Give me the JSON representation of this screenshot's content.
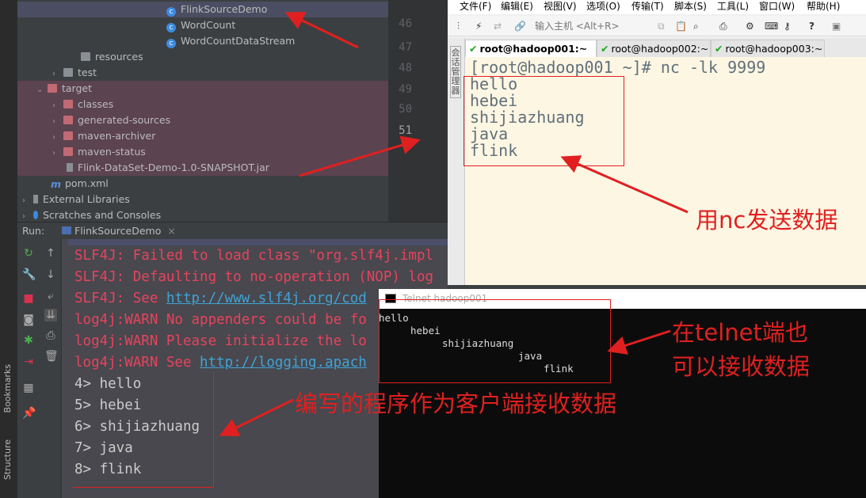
{
  "ide": {
    "left_strip": {
      "bookmarks": "Bookmarks",
      "structure": "Structure"
    },
    "tree": [
      {
        "label": "FlinkSourceDemo",
        "icon": "class-icon"
      },
      {
        "label": "WordCount",
        "icon": "class-icon"
      },
      {
        "label": "WordCountDataStream",
        "icon": "class-icon"
      },
      {
        "label": "resources",
        "icon": "folder-icon"
      },
      {
        "label": "test",
        "icon": "folder-icon"
      },
      {
        "label": "target",
        "icon": "folder-icon"
      },
      {
        "label": "classes",
        "icon": "folder-icon"
      },
      {
        "label": "generated-sources",
        "icon": "folder-icon"
      },
      {
        "label": "maven-archiver",
        "icon": "folder-icon"
      },
      {
        "label": "maven-status",
        "icon": "folder-icon"
      },
      {
        "label": "Flink-DataSet-Demo-1.0-SNAPSHOT.jar",
        "icon": "jar-icon"
      },
      {
        "label": "pom.xml",
        "icon": "maven-icon"
      },
      {
        "label": "External Libraries",
        "icon": "library-icon"
      },
      {
        "label": "Scratches and Consoles",
        "icon": "scratch-icon"
      }
    ],
    "line_numbers": [
      "46",
      "47",
      "48",
      "49",
      "50",
      "51"
    ],
    "run": {
      "label": "Run:",
      "tab": "FlinkSourceDemo"
    },
    "console": [
      {
        "text": "SLF4J: Failed to load class \"org.slf4j.impl",
        "type": "err"
      },
      {
        "text": "SLF4J: Defaulting to no-operation (NOP) log",
        "type": "err"
      },
      {
        "text": "SLF4J: See ",
        "link": "http://www.slf4j.org/cod",
        "type": "err"
      },
      {
        "text": "log4j:WARN No appenders could be fo",
        "type": "err"
      },
      {
        "text": "log4j:WARN Please initialize the lo",
        "type": "err"
      },
      {
        "text": "log4j:WARN See ",
        "link": "http://logging.apach",
        "type": "err"
      },
      {
        "text": "4> hello",
        "type": "out"
      },
      {
        "text": "5> hebei",
        "type": "out"
      },
      {
        "text": "6> shijiazhuang",
        "type": "out"
      },
      {
        "text": "7> java",
        "type": "out"
      },
      {
        "text": "8> flink",
        "type": "out"
      }
    ]
  },
  "xshell": {
    "menu": [
      "文件(F)",
      "编辑(E)",
      "视图(V)",
      "选项(O)",
      "传输(T)",
      "脚本(S)",
      "工具(L)",
      "窗口(W)",
      "帮助(H)"
    ],
    "host_placeholder": "输入主机 <Alt+R>",
    "session_manager": "会话管理器",
    "tabs": [
      {
        "label": "root@hadoop001:~",
        "active": true,
        "close": "×"
      },
      {
        "label": "root@hadoop002:~"
      },
      {
        "label": "root@hadoop003:~"
      }
    ],
    "terminal": [
      "[root@hadoop001 ~]# nc -lk 9999",
      "hello",
      "hebei",
      "shijiazhuang",
      "java",
      "flink"
    ]
  },
  "telnet": {
    "title": "Telnet hadoop001",
    "lines": [
      "hello",
      "hebei",
      "shijiazhuang",
      "java",
      "flink"
    ]
  },
  "annotations": {
    "nc": "用nc发送数据",
    "telnet1": "在telnet端也",
    "telnet2": "可以接收数据",
    "client": "编写的程序作为客户端接收数据",
    "color": "#e02020"
  }
}
